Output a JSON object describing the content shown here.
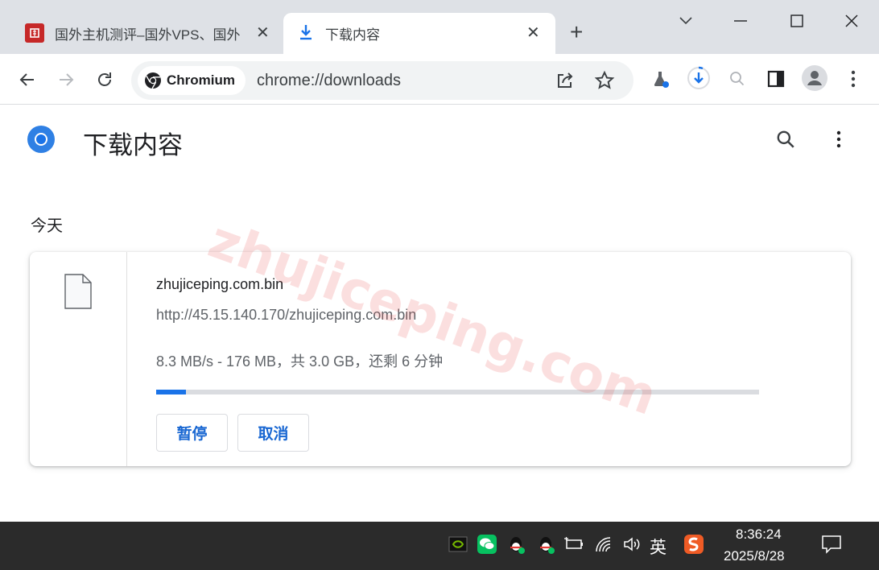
{
  "tabs": [
    {
      "title": "国外主机测评–国外VPS、国外",
      "active": false
    },
    {
      "title": "下载内容",
      "active": true
    }
  ],
  "toolbar": {
    "chip_label": "Chromium",
    "url": "chrome://downloads"
  },
  "page": {
    "title": "下载内容",
    "section_label": "今天",
    "watermark": "zhujiceping.com"
  },
  "download": {
    "file_name": "zhujiceping.com.bin",
    "url": "http://45.15.140.170/zhujiceping.com.bin",
    "status": "8.3 MB/s - 176 MB，共 3.0 GB，还剩 6 分钟",
    "progress_fraction": 0.05,
    "pause_label": "暂停",
    "cancel_label": "取消"
  },
  "taskbar": {
    "ime_label": "英",
    "time": "8:36:24",
    "date": "2025/8/28"
  },
  "colors": {
    "accent": "#1a73e8",
    "button_text": "#1967d2",
    "tabbar": "#dee1e6",
    "taskbar": "#2b2b2b"
  }
}
